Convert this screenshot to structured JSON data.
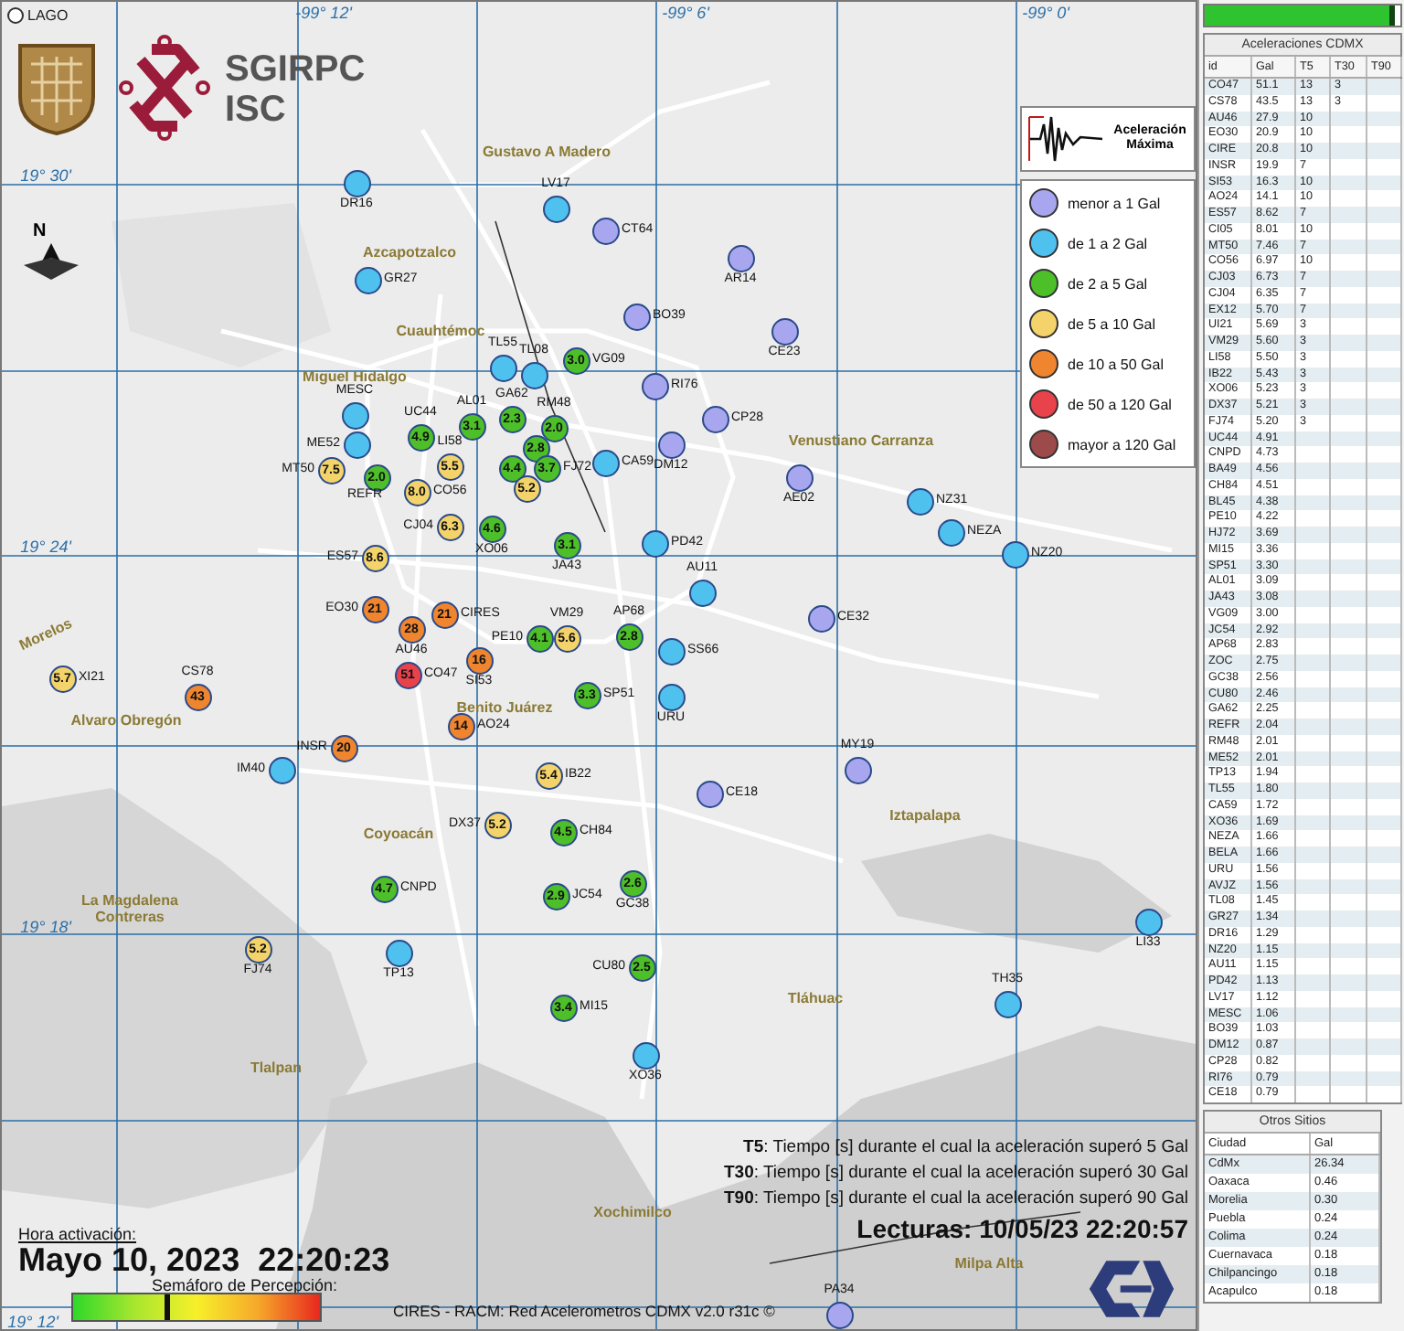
{
  "map": {
    "lake_label": "LAGO",
    "logo_text": [
      "SGIRPC",
      "ISC"
    ],
    "north_label": "N",
    "grid_labels": [
      "-99° 12'",
      "-99° 6'",
      "-99° 0'",
      "19° 30'",
      "19° 24'",
      "19° 18'",
      "19° 12'"
    ],
    "districts": [
      "Gustavo A Madero",
      "Azcapotzalco",
      "Miguel Hidalgo",
      "Cuauhtémoc",
      "Venustiano Carranza",
      "Morelos",
      "Alvaro Obregón",
      "Benito Juárez",
      "Coyoacán",
      "Iztapalapa",
      "La Magdalena Contreras",
      "Tlalpan",
      "Tláhuac",
      "Xochimilco",
      "Milpa Alta"
    ],
    "stations": [
      {
        "label": "DR16",
        "color": "#4fc1ee"
      },
      {
        "label": "LV17",
        "color": "#4fc1ee"
      },
      {
        "label": "CT64",
        "color": "#a8a6ee"
      },
      {
        "label": "GR27",
        "color": "#4fc1ee"
      },
      {
        "label": "AR14",
        "color": "#a8a6ee"
      },
      {
        "label": "BO39",
        "color": "#a8a6ee"
      },
      {
        "label": "CE23",
        "color": "#a8a6ee"
      },
      {
        "label": "TL55",
        "color": "#4fc1ee"
      },
      {
        "label": "TL08",
        "color": "#4fc1ee"
      },
      {
        "label": "VG09",
        "value": "3.0",
        "color": "#4dbf29"
      },
      {
        "label": "RI76",
        "color": "#a8a6ee"
      },
      {
        "label": "MESC",
        "color": "#4fc1ee"
      },
      {
        "label": "ME52",
        "color": "#4fc1ee"
      },
      {
        "label": "UC44",
        "value": "4.9",
        "color": "#4dbf29"
      },
      {
        "label": "AL01",
        "value": "3.1",
        "color": "#4dbf29"
      },
      {
        "label": "GA62",
        "value": "2.3",
        "color": "#4dbf29"
      },
      {
        "value": "2.8",
        "color": "#4dbf29"
      },
      {
        "label": "RM48",
        "value": "2.0",
        "color": "#4dbf29"
      },
      {
        "label": "DM12",
        "color": "#a8a6ee"
      },
      {
        "label": "CP28",
        "color": "#a8a6ee"
      },
      {
        "label": "MT50",
        "value": "7.5",
        "color": "#f4d46a"
      },
      {
        "label": "REFR",
        "value": "2.0",
        "color": "#4dbf29"
      },
      {
        "label": "LI58",
        "value": "5.5",
        "color": "#f4d46a"
      },
      {
        "label": "CO56",
        "value": "8.0",
        "color": "#f4d46a"
      },
      {
        "value": "4.4",
        "color": "#4dbf29"
      },
      {
        "value": "5.2",
        "color": "#f4d46a"
      },
      {
        "label": "FJ72",
        "value": "3.7",
        "color": "#4dbf29"
      },
      {
        "label": "CA59",
        "color": "#4fc1ee"
      },
      {
        "label": "AE02",
        "color": "#a8a6ee"
      },
      {
        "label": "NZ31",
        "color": "#4fc1ee"
      },
      {
        "label": "ES57",
        "value": "8.6",
        "color": "#f4d46a"
      },
      {
        "label": "CJ04",
        "value": "6.3",
        "color": "#f4d46a"
      },
      {
        "label": "XO06",
        "value": "4.6",
        "color": "#4dbf29"
      },
      {
        "label": "JA43",
        "value": "3.1",
        "color": "#4dbf29"
      },
      {
        "label": "PD42",
        "color": "#4fc1ee"
      },
      {
        "label": "NEZA",
        "color": "#4fc1ee"
      },
      {
        "label": "NZ20",
        "color": "#4fc1ee"
      },
      {
        "label": "EO30",
        "value": "21",
        "color": "#f0852f"
      },
      {
        "label": "CIRES",
        "value": "21",
        "color": "#f0852f"
      },
      {
        "label": "AU11",
        "color": "#4fc1ee"
      },
      {
        "label": "CE32",
        "color": "#a8a6ee"
      },
      {
        "label": "AU46",
        "value": "28",
        "color": "#f0852f"
      },
      {
        "label": "SI53",
        "value": "16",
        "color": "#f0852f"
      },
      {
        "label": "PE10",
        "value": "4.1",
        "color": "#4dbf29"
      },
      {
        "label": "VM29",
        "value": "5.6",
        "color": "#f4d46a"
      },
      {
        "label": "AP68",
        "value": "2.8",
        "color": "#4dbf29"
      },
      {
        "label": "SS66",
        "color": "#4fc1ee"
      },
      {
        "label": "XI21",
        "value": "5.7",
        "color": "#f4d46a"
      },
      {
        "label": "CS78",
        "value": "43",
        "color": "#f0852f"
      },
      {
        "label": "CO47",
        "value": "51",
        "color": "#e8424a"
      },
      {
        "label": "SP51",
        "value": "3.3",
        "color": "#4dbf29"
      },
      {
        "label": "URU",
        "color": "#4fc1ee"
      },
      {
        "label": "AO24",
        "value": "14",
        "color": "#f0852f"
      },
      {
        "label": "IM40",
        "color": "#4fc1ee"
      },
      {
        "label": "INSR",
        "value": "20",
        "color": "#f0852f"
      },
      {
        "label": "IB22",
        "value": "5.4",
        "color": "#f4d46a"
      },
      {
        "label": "CE18",
        "color": "#a8a6ee"
      },
      {
        "label": "MY19",
        "color": "#a8a6ee"
      },
      {
        "label": "DX37",
        "value": "5.2",
        "color": "#f4d46a"
      },
      {
        "label": "CH84",
        "value": "4.5",
        "color": "#4dbf29"
      },
      {
        "label": "CNPD",
        "value": "4.7",
        "color": "#4dbf29"
      },
      {
        "label": "JC54",
        "value": "2.9",
        "color": "#4dbf29"
      },
      {
        "label": "GC38",
        "value": "2.6",
        "color": "#4dbf29"
      },
      {
        "label": "FJ74",
        "value": "5.2",
        "color": "#f4d46a"
      },
      {
        "label": "TP13",
        "color": "#4fc1ee"
      },
      {
        "label": "CU80",
        "value": "2.5",
        "color": "#4dbf29"
      },
      {
        "label": "LI33",
        "color": "#4fc1ee"
      },
      {
        "label": "MI15",
        "value": "3.4",
        "color": "#4dbf29"
      },
      {
        "label": "TH35",
        "color": "#4fc1ee"
      },
      {
        "label": "XO36",
        "color": "#4fc1ee"
      },
      {
        "label": "PA34",
        "color": "#a8a6ee"
      }
    ],
    "legend": {
      "title": "Aceleración Máxima",
      "items": [
        {
          "label": "menor a 1 Gal",
          "color": "#a8a6ee"
        },
        {
          "label": "de 1 a 2 Gal",
          "color": "#4fc1ee"
        },
        {
          "label": "de 2 a 5 Gal",
          "color": "#4dbf29"
        },
        {
          "label": "de 5 a 10 Gal",
          "color": "#f4d46a"
        },
        {
          "label": "de 10 a 50 Gal",
          "color": "#f0852f"
        },
        {
          "label": "de 50 a 120 Gal",
          "color": "#e8424a"
        },
        {
          "label": "mayor a 120 Gal",
          "color": "#9c4a4a"
        }
      ]
    },
    "notes": [
      "**T5**: Tiempo [s] durante el cual la aceleración superó 5 Gal",
      "**T30**: Tiempo [s] durante el cual la aceleración superó 30 Gal",
      "**T90**: Tiempo [s] durante el cual la aceleración superó 90 Gal"
    ],
    "readings": "Lecturas: 10/05/23 22:20:57",
    "activation_label": "Hora activación:",
    "activation_time": "Mayo 10, 2023  22:20:23",
    "perception": {
      "label": "Semáforo de Percepción:",
      "level": 0.37
    },
    "footer": "CIRES - RACM: Red Acelerometros CDMX v2.0 r31c ©"
  },
  "side": {
    "progress": {
      "level": 0.97
    },
    "table": {
      "title": "Aceleraciones CDMX",
      "columns": [
        "id",
        "Gal",
        "T5",
        "T30",
        "T90"
      ],
      "rows": [
        [
          "CO47",
          "51.1",
          "13",
          "3",
          ""
        ],
        [
          "CS78",
          "43.5",
          "13",
          "3",
          ""
        ],
        [
          "AU46",
          "27.9",
          "10",
          "",
          ""
        ],
        [
          "EO30",
          "20.9",
          "10",
          "",
          ""
        ],
        [
          "CIRE",
          "20.8",
          "10",
          "",
          ""
        ],
        [
          "INSR",
          "19.9",
          "7",
          "",
          ""
        ],
        [
          "SI53",
          "16.3",
          "10",
          "",
          ""
        ],
        [
          "AO24",
          "14.1",
          "10",
          "",
          ""
        ],
        [
          "ES57",
          "8.62",
          "7",
          "",
          ""
        ],
        [
          "CI05",
          "8.01",
          "10",
          "",
          ""
        ],
        [
          "MT50",
          "7.46",
          "7",
          "",
          ""
        ],
        [
          "CO56",
          "6.97",
          "10",
          "",
          ""
        ],
        [
          "CJ03",
          "6.73",
          "7",
          "",
          ""
        ],
        [
          "CJ04",
          "6.35",
          "7",
          "",
          ""
        ],
        [
          "EX12",
          "5.70",
          "7",
          "",
          ""
        ],
        [
          "UI21",
          "5.69",
          "3",
          "",
          ""
        ],
        [
          "VM29",
          "5.60",
          "3",
          "",
          ""
        ],
        [
          "LI58",
          "5.50",
          "3",
          "",
          ""
        ],
        [
          "IB22",
          "5.43",
          "3",
          "",
          ""
        ],
        [
          "XO06",
          "5.23",
          "3",
          "",
          ""
        ],
        [
          "DX37",
          "5.21",
          "3",
          "",
          ""
        ],
        [
          "FJ74",
          "5.20",
          "3",
          "",
          ""
        ],
        [
          "UC44",
          "4.91",
          "",
          "",
          ""
        ],
        [
          "CNPD",
          "4.73",
          "",
          "",
          ""
        ],
        [
          "BA49",
          "4.56",
          "",
          "",
          ""
        ],
        [
          "CH84",
          "4.51",
          "",
          "",
          ""
        ],
        [
          "BL45",
          "4.38",
          "",
          "",
          ""
        ],
        [
          "PE10",
          "4.22",
          "",
          "",
          ""
        ],
        [
          "HJ72",
          "3.69",
          "",
          "",
          ""
        ],
        [
          "MI15",
          "3.36",
          "",
          "",
          ""
        ],
        [
          "SP51",
          "3.30",
          "",
          "",
          ""
        ],
        [
          "AL01",
          "3.09",
          "",
          "",
          ""
        ],
        [
          "JA43",
          "3.08",
          "",
          "",
          ""
        ],
        [
          "VG09",
          "3.00",
          "",
          "",
          ""
        ],
        [
          "JC54",
          "2.92",
          "",
          "",
          ""
        ],
        [
          "AP68",
          "2.83",
          "",
          "",
          ""
        ],
        [
          "ZOC",
          "2.75",
          "",
          "",
          ""
        ],
        [
          "GC38",
          "2.56",
          "",
          "",
          ""
        ],
        [
          "CU80",
          "2.46",
          "",
          "",
          ""
        ],
        [
          "GA62",
          "2.25",
          "",
          "",
          ""
        ],
        [
          "REFR",
          "2.04",
          "",
          "",
          ""
        ],
        [
          "RM48",
          "2.01",
          "",
          "",
          ""
        ],
        [
          "ME52",
          "2.01",
          "",
          "",
          ""
        ],
        [
          "TP13",
          "1.94",
          "",
          "",
          ""
        ],
        [
          "TL55",
          "1.80",
          "",
          "",
          ""
        ],
        [
          "CA59",
          "1.72",
          "",
          "",
          ""
        ],
        [
          "XO36",
          "1.69",
          "",
          "",
          ""
        ],
        [
          "NEZA",
          "1.66",
          "",
          "",
          ""
        ],
        [
          "BELA",
          "1.66",
          "",
          "",
          ""
        ],
        [
          "URU",
          "1.56",
          "",
          "",
          ""
        ],
        [
          "AVJZ",
          "1.56",
          "",
          "",
          ""
        ],
        [
          "TL08",
          "1.45",
          "",
          "",
          ""
        ],
        [
          "GR27",
          "1.34",
          "",
          "",
          ""
        ],
        [
          "DR16",
          "1.29",
          "",
          "",
          ""
        ],
        [
          "NZ20",
          "1.15",
          "",
          "",
          ""
        ],
        [
          "AU11",
          "1.15",
          "",
          "",
          ""
        ],
        [
          "PD42",
          "1.13",
          "",
          "",
          ""
        ],
        [
          "LV17",
          "1.12",
          "",
          "",
          ""
        ],
        [
          "MESC",
          "1.06",
          "",
          "",
          ""
        ],
        [
          "BO39",
          "1.03",
          "",
          "",
          ""
        ],
        [
          "DM12",
          "0.87",
          "",
          "",
          ""
        ],
        [
          "CP28",
          "0.82",
          "",
          "",
          ""
        ],
        [
          "RI76",
          "0.79",
          "",
          "",
          ""
        ],
        [
          "CE18",
          "0.79",
          "",
          "",
          ""
        ]
      ]
    },
    "others": {
      "title": "Otros Sitios",
      "columns": [
        "Ciudad",
        "Gal"
      ],
      "rows": [
        [
          "CdMx",
          "26.34"
        ],
        [
          "Oaxaca",
          "0.46"
        ],
        [
          "Morelia",
          "0.30"
        ],
        [
          "Puebla",
          "0.24"
        ],
        [
          "Colima",
          "0.24"
        ],
        [
          "Cuernavaca",
          "0.18"
        ],
        [
          "Chilpancingo",
          "0.18"
        ],
        [
          "Acapulco",
          "0.18"
        ]
      ]
    }
  }
}
